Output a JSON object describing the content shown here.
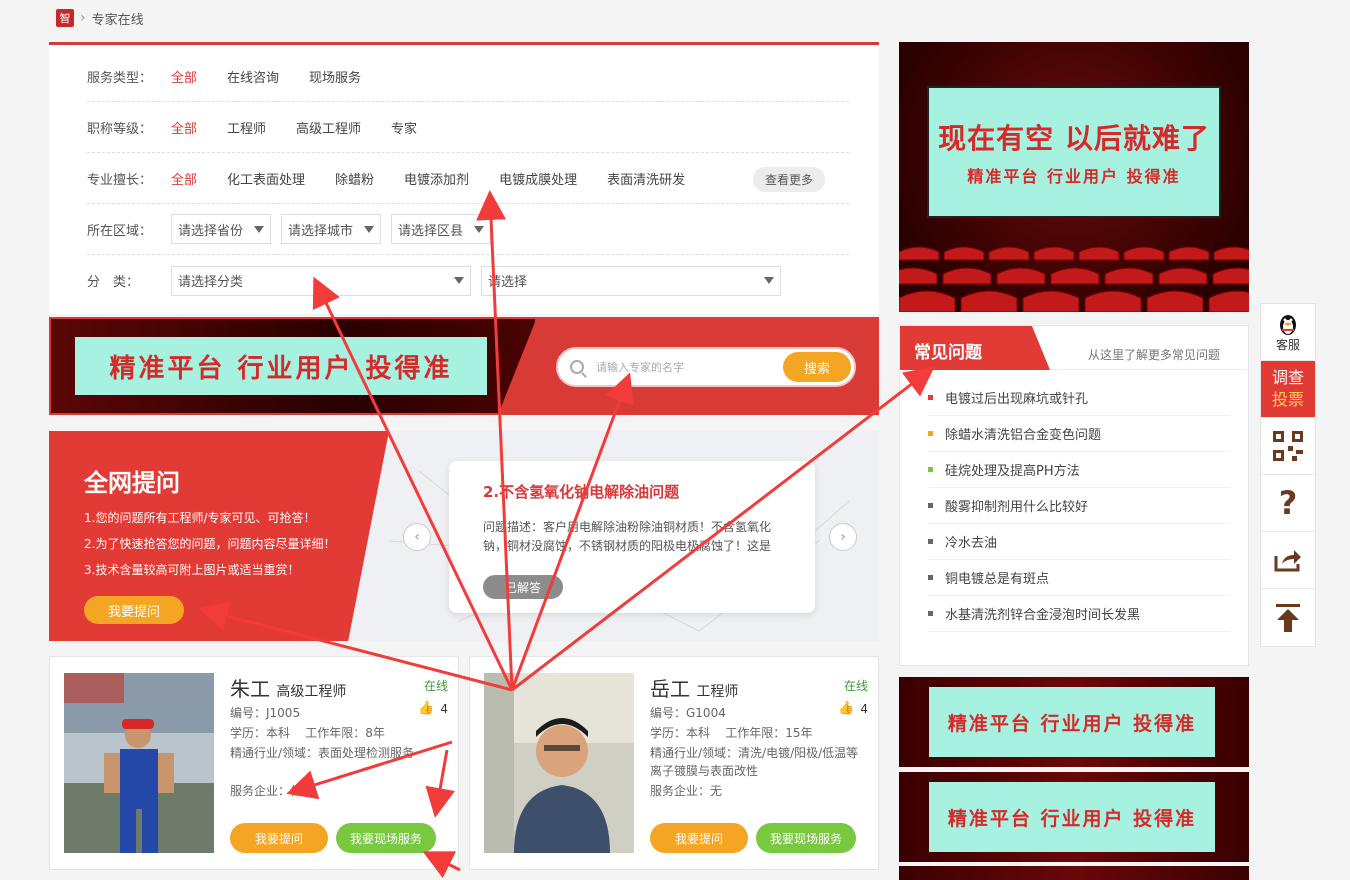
{
  "breadcrumb": {
    "logo": "智",
    "current": "专家在线"
  },
  "filters": {
    "service": {
      "label": "服务类型：",
      "options": [
        "全部",
        "在线咨询",
        "现场服务"
      ]
    },
    "level": {
      "label": "职称等级：",
      "options": [
        "全部",
        "工程师",
        "高级工程师",
        "专家"
      ]
    },
    "specialty": {
      "label": "专业擅长：",
      "options": [
        "全部",
        "化工表面处理",
        "除蜡粉",
        "电镀添加剂",
        "电镀成膜处理",
        "表面清洗研发"
      ],
      "more": "查看更多"
    },
    "region": {
      "label": "所在区域：",
      "province": "请选择省份",
      "city": "请选择城市",
      "county": "请选择区县"
    },
    "category": {
      "label": "分　类：",
      "main": "请选择分类",
      "sub": "请选择"
    }
  },
  "banner": {
    "ad": "精准平台 行业用户 投得准",
    "search_placeholder": "请输入专家的名字",
    "search_button": "搜索"
  },
  "ask": {
    "title": "全网提问",
    "lines": [
      "1.您的问题所有工程师/专家可见、可抢答！",
      "2.为了快速抢答您的问题，问题内容尽量详细！",
      "3.技术含量较高可附上图片或适当重赏！"
    ],
    "button": "我要提问",
    "card": {
      "title": "2.不含氢氧化钠电解除油问题",
      "desc": "问题描述：客户用电解除油粉除油铜材质！不含氢氧化钠，铜材没腐蚀，不锈钢材质的阳极电极腐蚀了！这是为",
      "status": "已解答"
    }
  },
  "experts": [
    {
      "name": "朱工",
      "title": "高级工程师",
      "status": "在线",
      "likes": "4",
      "id": "编号：J1005",
      "edu": "学历：本科",
      "years": "工作年限：8年",
      "field": "精通行业/领域：表面处理检测服务",
      "company": "服务企业：保密",
      "ask": "我要提问",
      "service": "我要现场服务"
    },
    {
      "name": "岳工",
      "title": "工程师",
      "status": "在线",
      "likes": "4",
      "id": "编号：G1004",
      "edu": "学历：本科",
      "years": "工作年限：15年",
      "field": "精通行业/领域：清洗/电镀/阳极/低温等离子镀膜与表面改性",
      "company": "服务企业：无",
      "ask": "我要提问",
      "service": "我要现场服务"
    }
  ],
  "right_ad": {
    "big": "现在有空 以后就难了",
    "small": "精准平台 行业用户 投得准"
  },
  "faq": {
    "title": "常见问题",
    "subtitle": "从这里了解更多常见问题",
    "items": [
      "电镀过后出现麻坑或针孔",
      "除蜡水清洗铝合金变色问题",
      "硅烷处理及提高PH方法",
      "酸雾抑制剂用什么比较好",
      "冷水去油",
      "铜电镀总是有斑点",
      "水基清洗剂锌合金浸泡时间长发黑"
    ],
    "dot_colors": [
      "#e23a35",
      "#f5a524",
      "#78c840",
      "#666666",
      "#666666",
      "#666666",
      "#666666"
    ]
  },
  "small_ads": [
    "精准平台 行业用户 投得准",
    "精准平台 行业用户 投得准"
  ],
  "toolbar": {
    "service": "客服",
    "vote_a": "调查",
    "vote_b": "投票",
    "help": "?"
  }
}
